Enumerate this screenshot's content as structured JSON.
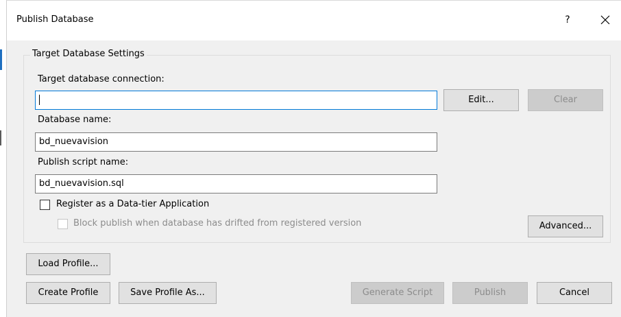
{
  "window": {
    "title": "Publish Database",
    "help_glyph": "?",
    "close_icon": "close-icon"
  },
  "target_settings": {
    "group_title": "Target Database Settings",
    "connection_label": "Target database connection:",
    "connection_value": "",
    "edit_label": "Edit...",
    "clear_label": "Clear",
    "database_name_label": "Database name:",
    "database_name_value": "bd_nuevavision",
    "script_name_label": "Publish script name:",
    "script_name_value": "bd_nuevavision.sql",
    "register_label": "Register as a Data-tier Application",
    "register_checked": false,
    "block_label": "Block publish when database has drifted from registered version",
    "block_checked": false,
    "advanced_label": "Advanced..."
  },
  "footer": {
    "load_profile_label": "Load Profile...",
    "create_profile_label": "Create Profile",
    "save_profile_label": "Save Profile As...",
    "generate_script_label": "Generate Script",
    "publish_label": "Publish",
    "cancel_label": "Cancel"
  }
}
